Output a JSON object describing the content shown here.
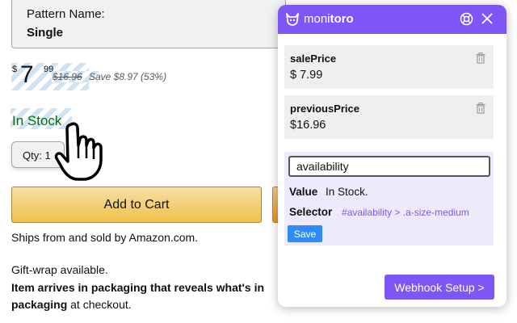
{
  "product": {
    "pattern_label": "Pattern Name:",
    "pattern_value": "Single",
    "price_currency": "$",
    "price_whole": "7",
    "price_fraction": "99",
    "previous_price": "$16.96",
    "savings": "Save $8.97 (53%)",
    "stock": "In Stock",
    "qty_label": "Qty:",
    "qty_value": "1",
    "add_to_cart": "Add to Cart",
    "ships_sold": "Ships from and sold by Amazon.com.",
    "gift_wrap": "Gift-wrap available.",
    "packaging_bold_1": "Item arrives in packaging that reveals what's in",
    "packaging_bold_2": "packaging",
    "packaging_rest": " at checkout."
  },
  "extension": {
    "brand_prefix": "moni",
    "brand_suffix": "toro",
    "fields": [
      {
        "name": "salePrice",
        "value": "$ 7.99"
      },
      {
        "name": "previousPrice",
        "value": "$16.96"
      }
    ],
    "edit": {
      "input_value": "availability",
      "value_label": "Value",
      "value_text": "In Stock.",
      "selector_label": "Selector",
      "selector_text": "#availability > .a-size-medium",
      "save_label": "Save"
    },
    "webhook_label": "Webhook Setup >"
  },
  "colors": {
    "accent": "#7d56f5",
    "save_button": "#2f8cf7",
    "stock_green": "#007600",
    "highlight_stripe": "#cfe3f4"
  },
  "icons": [
    "cursor-hand-icon",
    "monitoro-logo-icon",
    "help-icon",
    "close-icon",
    "trash-icon"
  ]
}
